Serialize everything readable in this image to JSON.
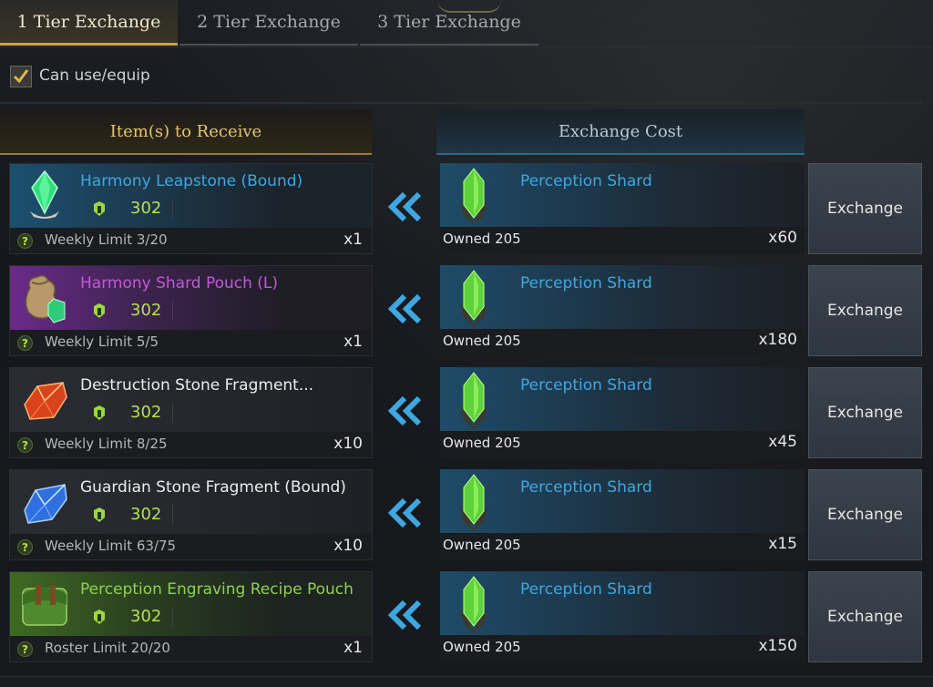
{
  "tabs": [
    {
      "label": "1 Tier Exchange",
      "active": true
    },
    {
      "label": "2 Tier Exchange",
      "active": false
    },
    {
      "label": "3 Tier Exchange",
      "active": false
    }
  ],
  "filter": {
    "label": "Can use/equip",
    "checked": true
  },
  "headers": {
    "receive": "Item(s) to Receive",
    "cost": "Exchange Cost"
  },
  "rows": [
    {
      "name": "Harmony Leapstone (Bound)",
      "name_color": "#3fa7e0",
      "level": "302",
      "limit": "Weekly Limit 3/20",
      "qty": "x1",
      "cost_name": "Perception Shard",
      "owned": "Owned 205",
      "cost_qty": "x60",
      "button": "Exchange",
      "icon": "leapstone-icon"
    },
    {
      "name": "Harmony Shard Pouch (L)",
      "name_color": "#c25ad8",
      "level": "302",
      "limit": "Weekly Limit 5/5",
      "qty": "x1",
      "cost_name": "Perception Shard",
      "owned": "Owned 205",
      "cost_qty": "x180",
      "button": "Exchange",
      "icon": "shard-pouch-icon"
    },
    {
      "name": "Destruction Stone Fragment...",
      "name_color": "#ececec",
      "level": "302",
      "limit": "Weekly Limit 8/25",
      "qty": "x10",
      "cost_name": "Perception Shard",
      "owned": "Owned 205",
      "cost_qty": "x45",
      "button": "Exchange",
      "icon": "destruction-stone-icon"
    },
    {
      "name": "Guardian Stone Fragment (Bound)",
      "name_color": "#ececec",
      "level": "302",
      "limit": "Weekly Limit 63/75",
      "qty": "x10",
      "cost_name": "Perception Shard",
      "owned": "Owned 205",
      "cost_qty": "x15",
      "button": "Exchange",
      "icon": "guardian-stone-icon"
    },
    {
      "name": "Perception Engraving Recipe Pouch",
      "name_color": "#8fd14f",
      "level": "302",
      "limit": "Roster Limit 20/20",
      "qty": "x1",
      "cost_name": "Perception Shard",
      "owned": "Owned 205",
      "cost_qty": "x150",
      "button": "Exchange",
      "icon": "recipe-pouch-icon"
    }
  ]
}
